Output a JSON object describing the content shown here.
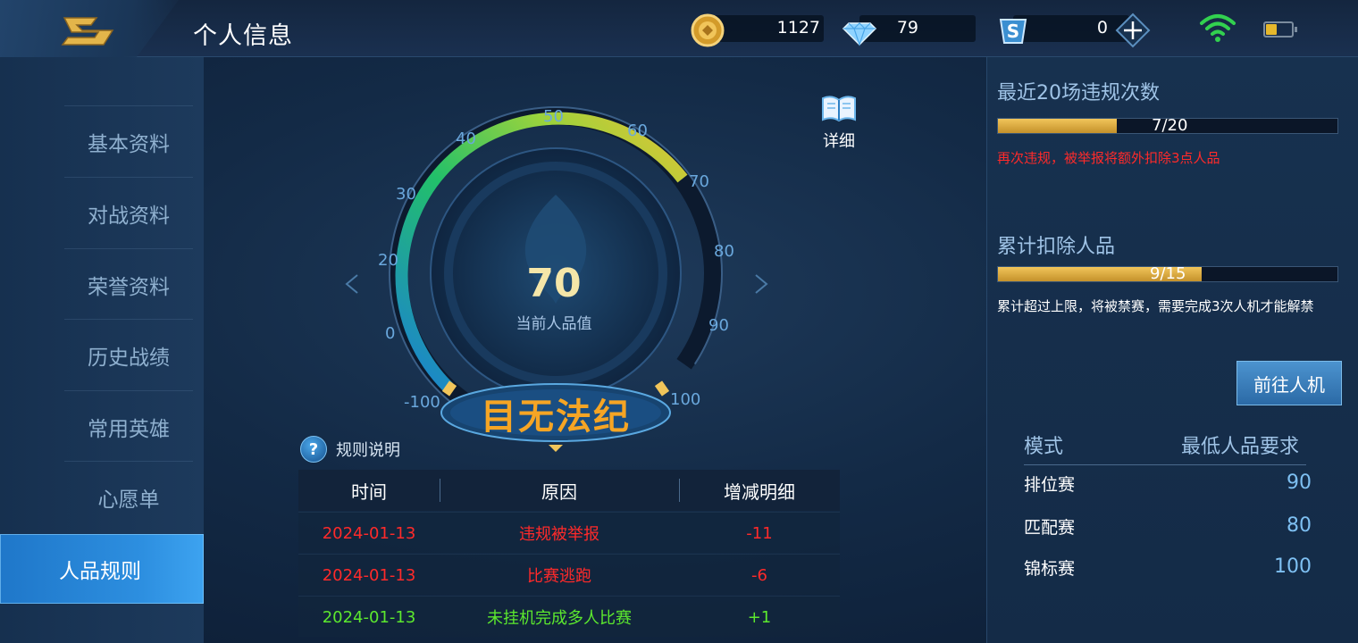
{
  "header": {
    "title": "个人信息",
    "gold": "1127",
    "diamond": "79",
    "voucher": "0"
  },
  "sidebar": {
    "items": [
      {
        "label": "基本资料"
      },
      {
        "label": "对战资料"
      },
      {
        "label": "荣誉资料"
      },
      {
        "label": "历史战绩"
      },
      {
        "label": "常用英雄"
      },
      {
        "label": "心愿单"
      },
      {
        "label": "人品规则"
      }
    ],
    "active_index": 6
  },
  "gauge": {
    "value": "70",
    "label": "当前人品值",
    "level": "目无法纪",
    "detail_label": "详细",
    "ticks": [
      "-100",
      "0",
      "20",
      "30",
      "40",
      "50",
      "60",
      "70",
      "80",
      "90",
      "100"
    ]
  },
  "rules": {
    "label": "规则说明"
  },
  "table": {
    "headers": [
      "时间",
      "原因",
      "增减明细"
    ],
    "rows": [
      {
        "time": "2024-01-13",
        "reason": "违规被举报",
        "delta": "-11",
        "color": "#ff2a2a"
      },
      {
        "time": "2024-01-13",
        "reason": "比赛逃跑",
        "delta": "-6",
        "color": "#ff2a2a"
      },
      {
        "time": "2024-01-13",
        "reason": "未挂机完成多人比赛",
        "delta": "+1",
        "color": "#5ce82e"
      }
    ]
  },
  "violations": {
    "title": "最近20场违规次数",
    "progress_text": "7/20",
    "progress_fraction": 0.35,
    "warning": "再次违规，被举报将额外扣除3点人品"
  },
  "deductions": {
    "title": "累计扣除人品",
    "progress_text": "9/15",
    "progress_fraction": 0.6,
    "note": "累计超过上限，将被禁赛，需要完成3次人机才能解禁"
  },
  "go_button": "前往人机",
  "modes": {
    "head_mode": "模式",
    "head_req": "最低人品要求",
    "rows": [
      {
        "name": "排位赛",
        "min": "90"
      },
      {
        "name": "匹配赛",
        "min": "80"
      },
      {
        "name": "锦标赛",
        "min": "100"
      }
    ]
  },
  "colors": {
    "accent_gold": "#f1c55a",
    "level_orange": "#f6a524",
    "warning_red": "#ff2a2a",
    "positive_green": "#5ce82e",
    "sidebar_active": "#2d8fe0"
  }
}
